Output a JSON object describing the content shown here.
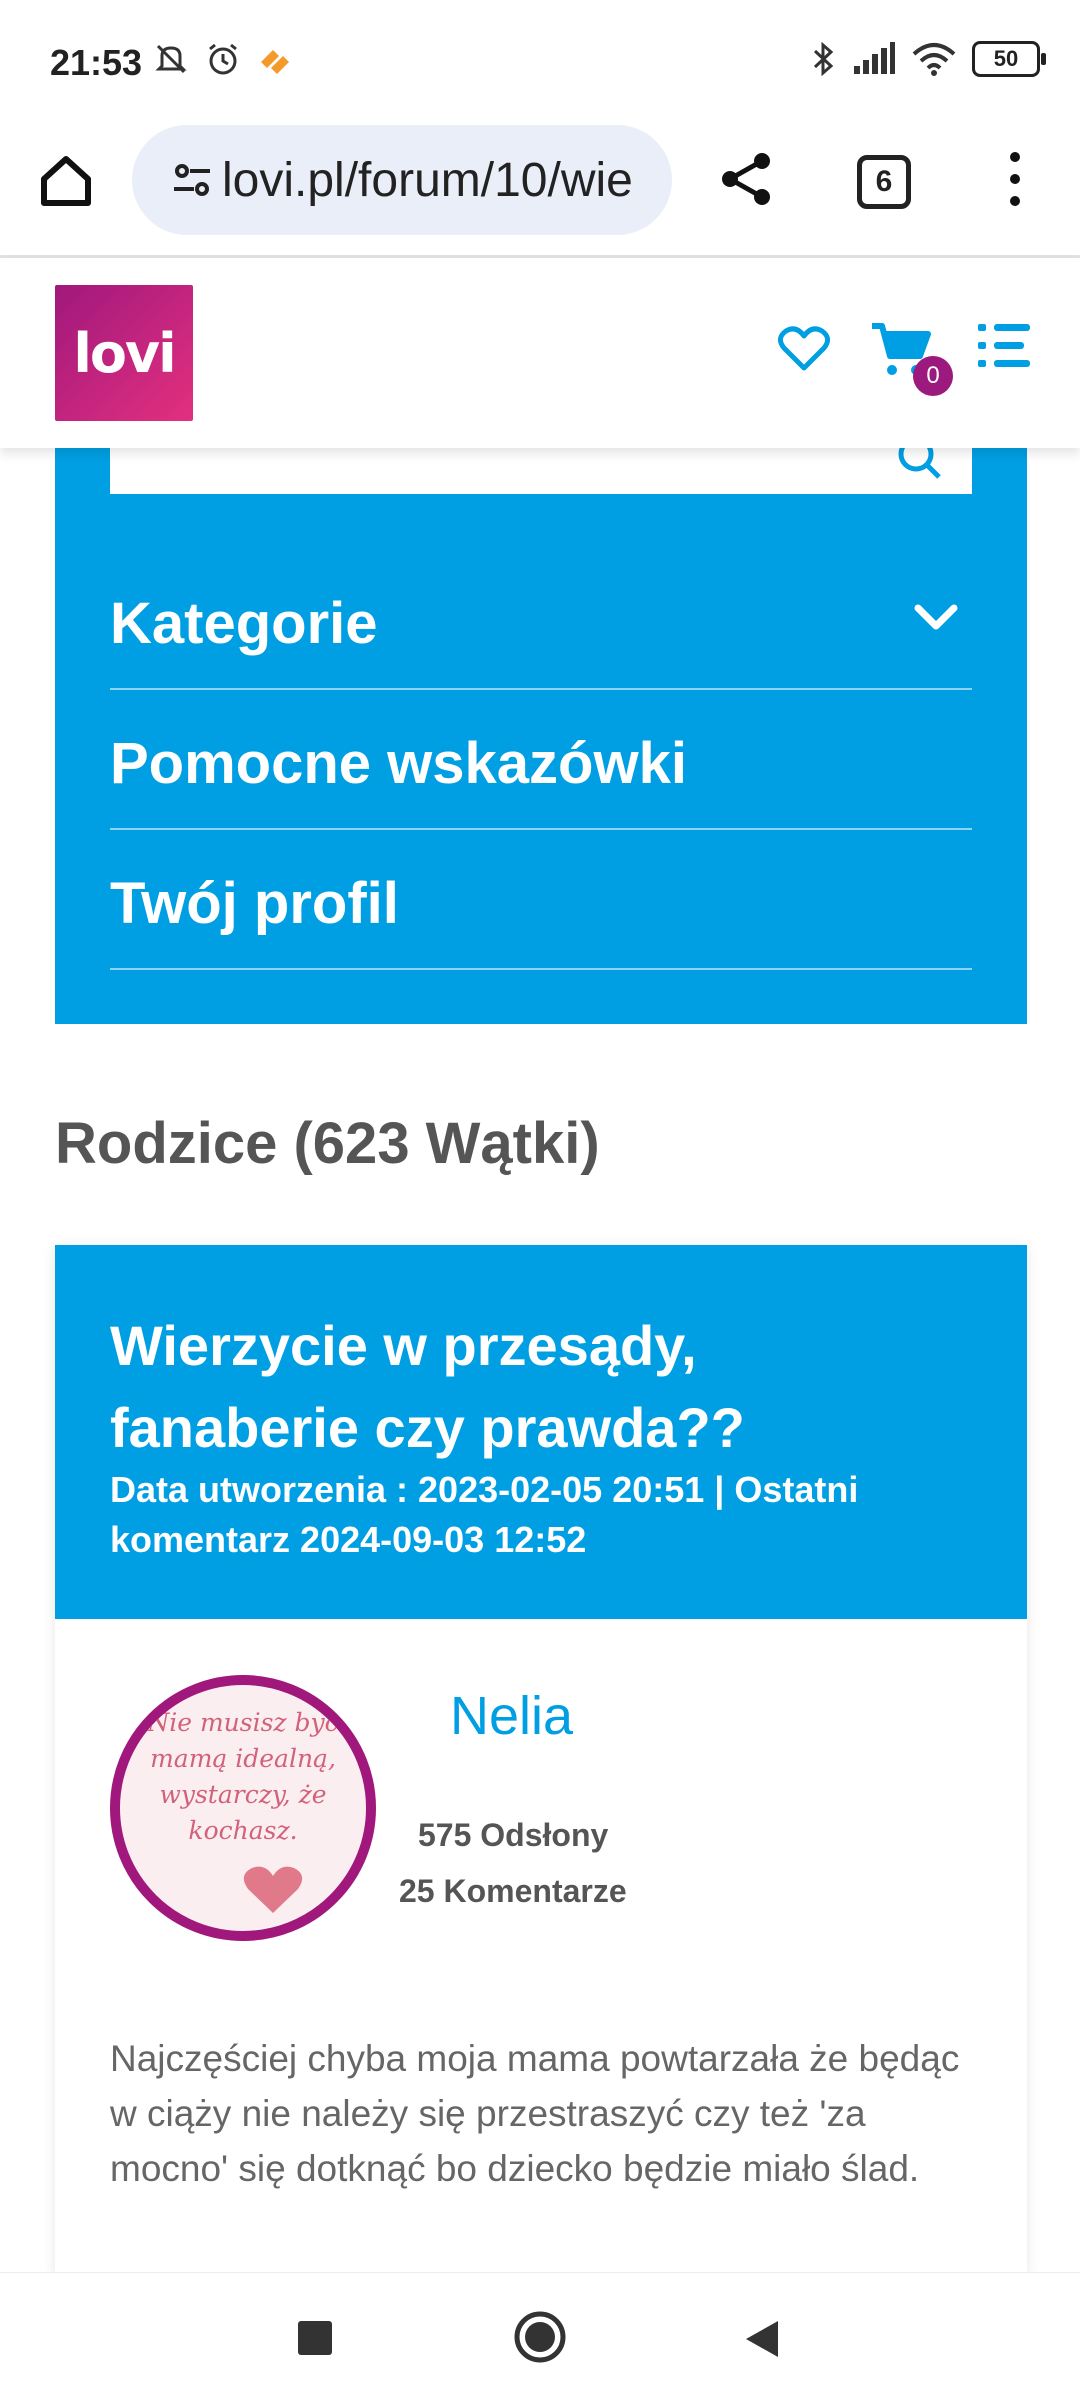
{
  "status_bar": {
    "time": "21:53",
    "battery": "50",
    "icons": [
      "mute-icon",
      "alarm-icon",
      "app-notification-icon",
      "bluetooth-icon",
      "signal-icon",
      "wifi-icon",
      "battery-icon"
    ]
  },
  "browser": {
    "url": "lovi.pl/forum/10/wie",
    "tab_count": "6"
  },
  "site": {
    "logo_text": "lovi",
    "cart_count": "0"
  },
  "forum_menu": {
    "items": [
      {
        "label": "Kategorie"
      },
      {
        "label": "Pomocne wskazówki"
      },
      {
        "label": "Twój profil"
      }
    ]
  },
  "section": {
    "title": "Rodzice (623 Wątki)"
  },
  "thread": {
    "title": "Wierzycie w przesądy, fanaberie czy prawda??",
    "meta": "Data utworzenia : 2023-02-05 20:51 | Ostatni komentarz 2024-09-03 12:52",
    "author": "Nelia",
    "avatar_text": "Nie musisz być mamą idealną, wystarczy, że kochasz.",
    "views": "575 Odsłony",
    "comments": "25 Komentarze",
    "body": "Najczęściej chyba moja mama powtarzała że będąc w ciąży nie należy się przestraszyć czy też 'za mocno' się dotknąć bo dziecko będzie miało ślad."
  },
  "colors": {
    "brand_blue": "#009fe3",
    "brand_magenta": "#a0187c"
  }
}
